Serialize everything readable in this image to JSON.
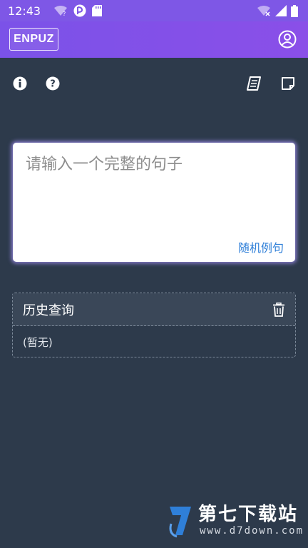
{
  "status_bar": {
    "time": "12:43"
  },
  "app_bar": {
    "logo_label": "ENPUZ",
    "account_icon": "account-circle-icon"
  },
  "toolbar": {
    "left": [
      "info-icon",
      "help-icon"
    ],
    "right": [
      "book-icon",
      "note-icon"
    ]
  },
  "input": {
    "placeholder": "请输入一个完整的句子",
    "value": "",
    "random_label": "随机例句"
  },
  "history": {
    "title": "历史查询",
    "empty_label": "(暂无)"
  },
  "watermark": {
    "brand": "第七下载站",
    "url": "www.d7down.com"
  },
  "colors": {
    "accent": "#7e57e6",
    "background": "#2d3a4b",
    "link": "#2f7fd8"
  }
}
